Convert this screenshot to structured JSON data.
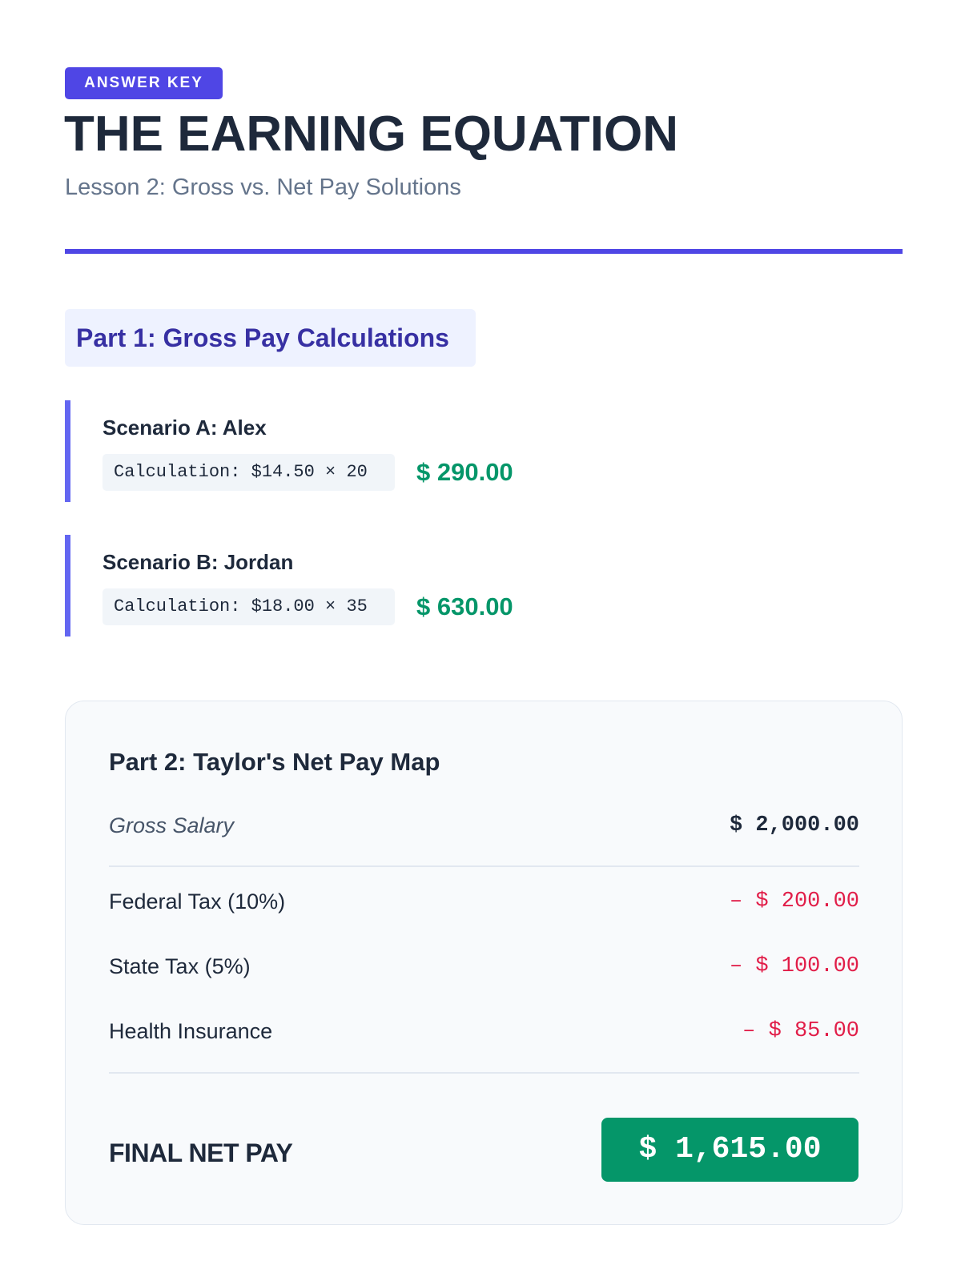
{
  "header": {
    "badge": "ANSWER KEY",
    "title": "THE EARNING EQUATION",
    "subtitle": "Lesson 2: Gross vs. Net Pay Solutions"
  },
  "part1": {
    "heading": "Part 1: Gross Pay Calculations",
    "scenarios": [
      {
        "name": "Scenario A: Alex",
        "calculation": "Calculation: $14.50 × 20",
        "result": "$ 290.00"
      },
      {
        "name": "Scenario B: Jordan",
        "calculation": "Calculation: $18.00 × 35",
        "result": "$ 630.00"
      }
    ]
  },
  "part2": {
    "heading": "Part 2: Taylor's Net Pay Map",
    "gross": {
      "label": "Gross Salary",
      "value": "$ 2,000.00"
    },
    "deductions": [
      {
        "label": "Federal Tax (10%)",
        "value": "– $ 200.00"
      },
      {
        "label": "State Tax (5%)",
        "value": "– $ 100.00"
      },
      {
        "label": "Health Insurance",
        "value": "– $ 85.00"
      }
    ],
    "final": {
      "label": "FINAL NET PAY",
      "value": "$ 1,615.00"
    }
  },
  "colors": {
    "accent": "#4f46e5",
    "positive": "#059669",
    "negative": "#e11d48",
    "text": "#1e293b"
  }
}
